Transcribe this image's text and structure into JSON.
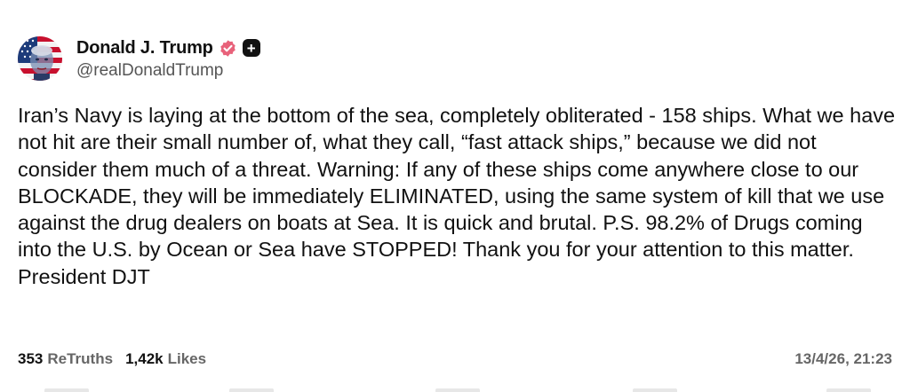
{
  "author": {
    "display_name": "Donald J. Trump",
    "handle": "@realDonaldTrump",
    "verified_icon": "verified-badge-icon",
    "follow_icon": "plus-icon",
    "follow_symbol": "+"
  },
  "post": {
    "text": "Iran’s Navy is laying at the bottom of the sea, completely obliterated - 158 ships. What we have not hit are their small number of, what they call, “fast attack ships,” because we did not consider them much of a threat. Warning: If any of these ships come anywhere close to our BLOCKADE, they will be immediately ELIMINATED, using the same system of kill that we use against the drug dealers on boats at Sea. It is quick and brutal. P.S. 98.2% of Drugs coming into the U.S. by Ocean or Sea have STOPPED! Thank you for your attention to this matter. President DJT"
  },
  "stats": {
    "retruths_count": "353",
    "retruths_label": "ReTruths",
    "likes_count": "1,42k",
    "likes_label": "Likes"
  },
  "timestamp": "13/4/26, 21:23",
  "colors": {
    "verified": "#e8627a",
    "text": "#111111",
    "muted": "#666666"
  }
}
